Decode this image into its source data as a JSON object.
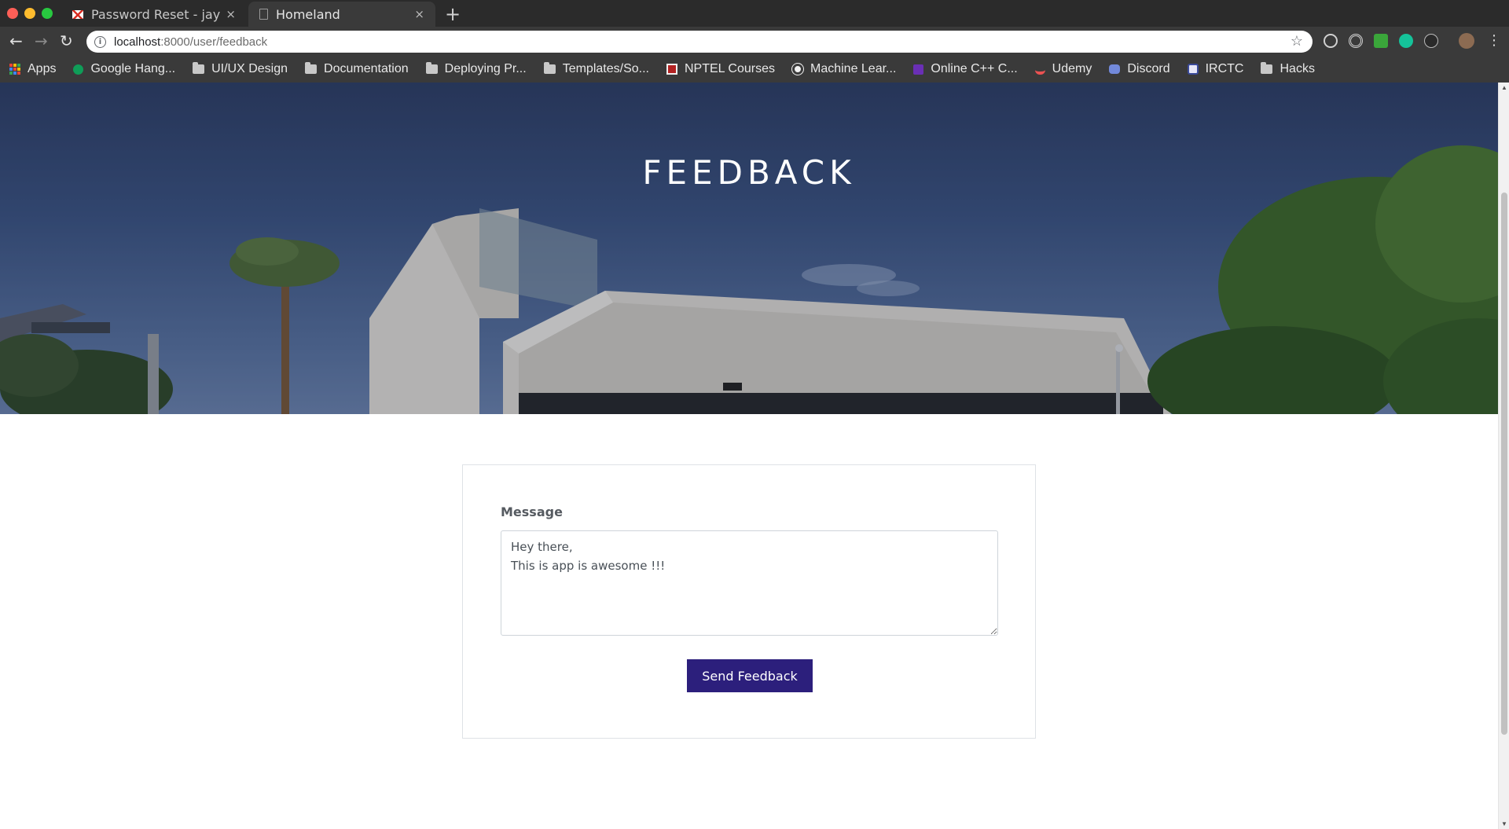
{
  "browser": {
    "tabs": [
      {
        "label": "Password Reset - jaygala",
        "close": "×",
        "favicon": "gmail-icon"
      },
      {
        "label": "Homeland",
        "close": "×",
        "favicon": "document-icon"
      }
    ],
    "new_tab": "+",
    "nav": {
      "back": "←",
      "forward": "→",
      "reload": "↻"
    },
    "url": {
      "host": "localhost",
      "rest": ":8000/user/feedback"
    },
    "bookmark_star": "☆",
    "menu": "⋮",
    "bookmarks": [
      {
        "label": "Apps",
        "icon": "apps-grid-icon"
      },
      {
        "label": "Google Hang...",
        "icon": "hangouts-icon"
      },
      {
        "label": "UI/UX Design",
        "icon": "folder-icon"
      },
      {
        "label": "Documentation",
        "icon": "folder-icon"
      },
      {
        "label": "Deploying Pr...",
        "icon": "folder-icon"
      },
      {
        "label": "Templates/So...",
        "icon": "folder-icon"
      },
      {
        "label": "NPTEL Courses",
        "icon": "nptel-icon"
      },
      {
        "label": "Machine Lear...",
        "icon": "ml-icon"
      },
      {
        "label": "Online C++ C...",
        "icon": "cpp-icon"
      },
      {
        "label": "Udemy",
        "icon": "udemy-icon"
      },
      {
        "label": "Discord",
        "icon": "discord-icon"
      },
      {
        "label": "IRCTC",
        "icon": "irctc-icon"
      },
      {
        "label": "Hacks",
        "icon": "folder-icon"
      }
    ]
  },
  "hero": {
    "title": "FEEDBACK"
  },
  "form": {
    "message_label": "Message",
    "message_value": "Hey there,\nThis is app is awesome !!!",
    "submit_label": "Send Feedback"
  },
  "colors": {
    "button": "#2c1f7c",
    "chrome": "#3a3a3a"
  }
}
